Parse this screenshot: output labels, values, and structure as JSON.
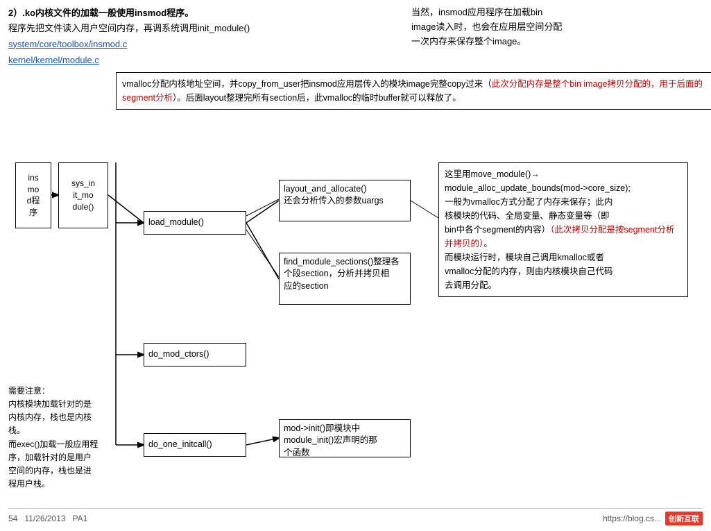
{
  "header": {
    "title": "2）.ko内核文件的加载一般使用insmod程序。",
    "desc1": "程序先把文件读入用户空间内存，再调系统调用init_module()",
    "link1": "system/core/toolbox/insmod.c",
    "link2": "kernel/kernel/module.c",
    "right_text1": "当然，insmod应用程序在加载bin",
    "right_text2": "image读入时，也会在应用层空间分配",
    "right_text3": "一次内存来保存整个image。"
  },
  "vmalloc_box": {
    "line1": "vmalloc分配内核地址空间，并copy_from_user把insmod应用层传入的模块image完整copy过来（",
    "line1_red": "此次分配内存是整个bin image拷贝分配的，用于后面的segment分析",
    "line1_end": "）。后面layout整理完所有section后，此vmalloc的临时buffer就可以释放了。"
  },
  "boxes": {
    "insmod": "ins\nmo\nd程\n序",
    "sysinit": "sys_in\nit_mo\ndule()",
    "load_module": "load_module()",
    "layout": {
      "line1": "layout_and_allocate()",
      "line2": "还会分析传入的参数uargs"
    },
    "find": {
      "line1": "find_module_sections()整理各",
      "line2": "个段section，分析并拷贝相",
      "line3": "应的section"
    },
    "do_mod_ctors": "do_mod_ctors()",
    "do_one_initcall": "do_one_initcall()",
    "mod_init": {
      "line1": "mod->init()即模块中",
      "line2": "module_init()宏声明的那",
      "line3": "个函数"
    }
  },
  "move_box": {
    "line1": "这里用move_module()→",
    "line2": "module_alloc_update_bounds(mod->core_size);",
    "line3": "一般为vmalloc方式分配了内存来保存；此内",
    "line4": "核模块的代码、全局变量、静态变量等（即",
    "line5": "bin中各个segment的内容）",
    "line5_red": "（此次拷贝分配是按segment分析并拷贝的）",
    "line6": "。",
    "line7": "而模块运行时，模块自己调用kmalloc或者",
    "line8": "vmalloc分配的内存，则由内核模块自己代码",
    "line9": "去调用分配。"
  },
  "note_left": {
    "line1": "需要注意：",
    "line2": "内核模块加载针对的是",
    "line3": "内核内存，栈也是内核",
    "line4": "栈。",
    "line5": "而exec()加载一般应用程",
    "line6": "序，加载针对的是用户",
    "line7": "空间的内存，栈也是进",
    "line8": "程用户栈。"
  },
  "footer": {
    "page": "54",
    "date": "11/26/2013",
    "label": "PA1",
    "url": "https://blog.cs...",
    "logo_text": "创新互联"
  }
}
